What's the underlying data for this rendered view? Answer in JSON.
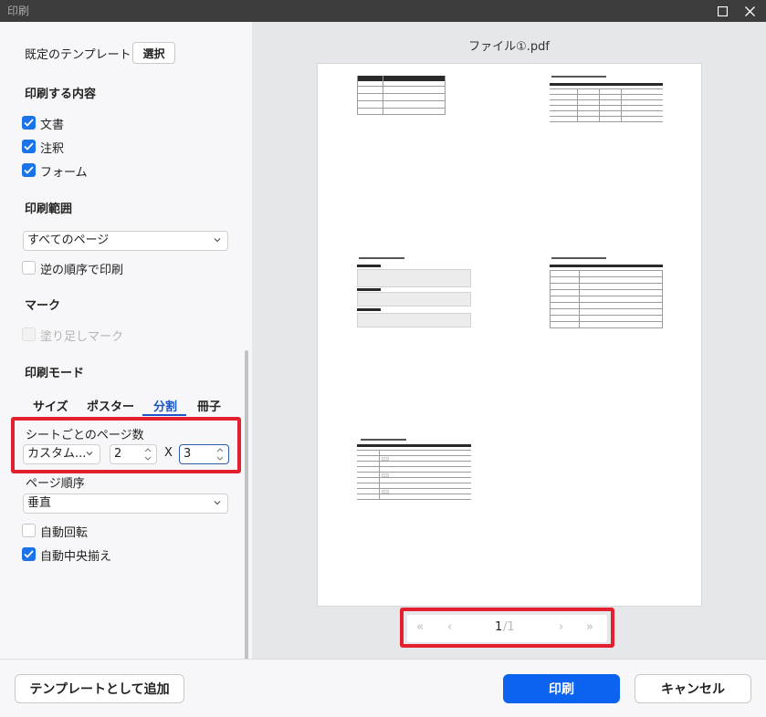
{
  "window": {
    "title": "印刷",
    "maximize_icon": "maximize-icon",
    "close_icon": "close-icon"
  },
  "settings": {
    "template_label": "既定のテンプレート",
    "template_select_button": "選択",
    "content_section": "印刷する内容",
    "content_items": [
      {
        "label": "文書",
        "checked": true
      },
      {
        "label": "注釈",
        "checked": true
      },
      {
        "label": "フォーム",
        "checked": true
      }
    ],
    "range_section": "印刷範囲",
    "range_value": "すべてのページ",
    "reverse_order_label": "逆の順序で印刷",
    "reverse_order_checked": false,
    "marks_section": "マーク",
    "bleed_marks_label": "塗り足しマーク",
    "bleed_marks_enabled": false,
    "mode_section": "印刷モード",
    "mode_tabs": [
      "サイズ",
      "ポスター",
      "分割",
      "冊子"
    ],
    "mode_active": "分割",
    "pages_per_sheet_label": "シートごとのページ数",
    "pages_per_sheet_preset": "カスタム...",
    "pages_per_sheet_cols": "2",
    "pages_per_sheet_x": "X",
    "pages_per_sheet_rows": "3",
    "page_order_label": "ページ順序",
    "page_order_value": "垂直",
    "auto_rotate_label": "自動回転",
    "auto_rotate_checked": false,
    "auto_center_label": "自動中央揃え",
    "auto_center_checked": true
  },
  "preview": {
    "file_name": "ファイル①.pdf",
    "pager": {
      "first": "«",
      "prev": "‹",
      "current": "1",
      "separator_total": "/1",
      "next": "›",
      "last": "»"
    }
  },
  "footer": {
    "add_template_button": "テンプレートとして追加",
    "print_button": "印刷",
    "cancel_button": "キャンセル"
  },
  "colors": {
    "accent": "#0b63f0",
    "checkbox": "#1a73e8",
    "highlight_border": "#e3202e",
    "titlebar": "#3c3c3c"
  }
}
